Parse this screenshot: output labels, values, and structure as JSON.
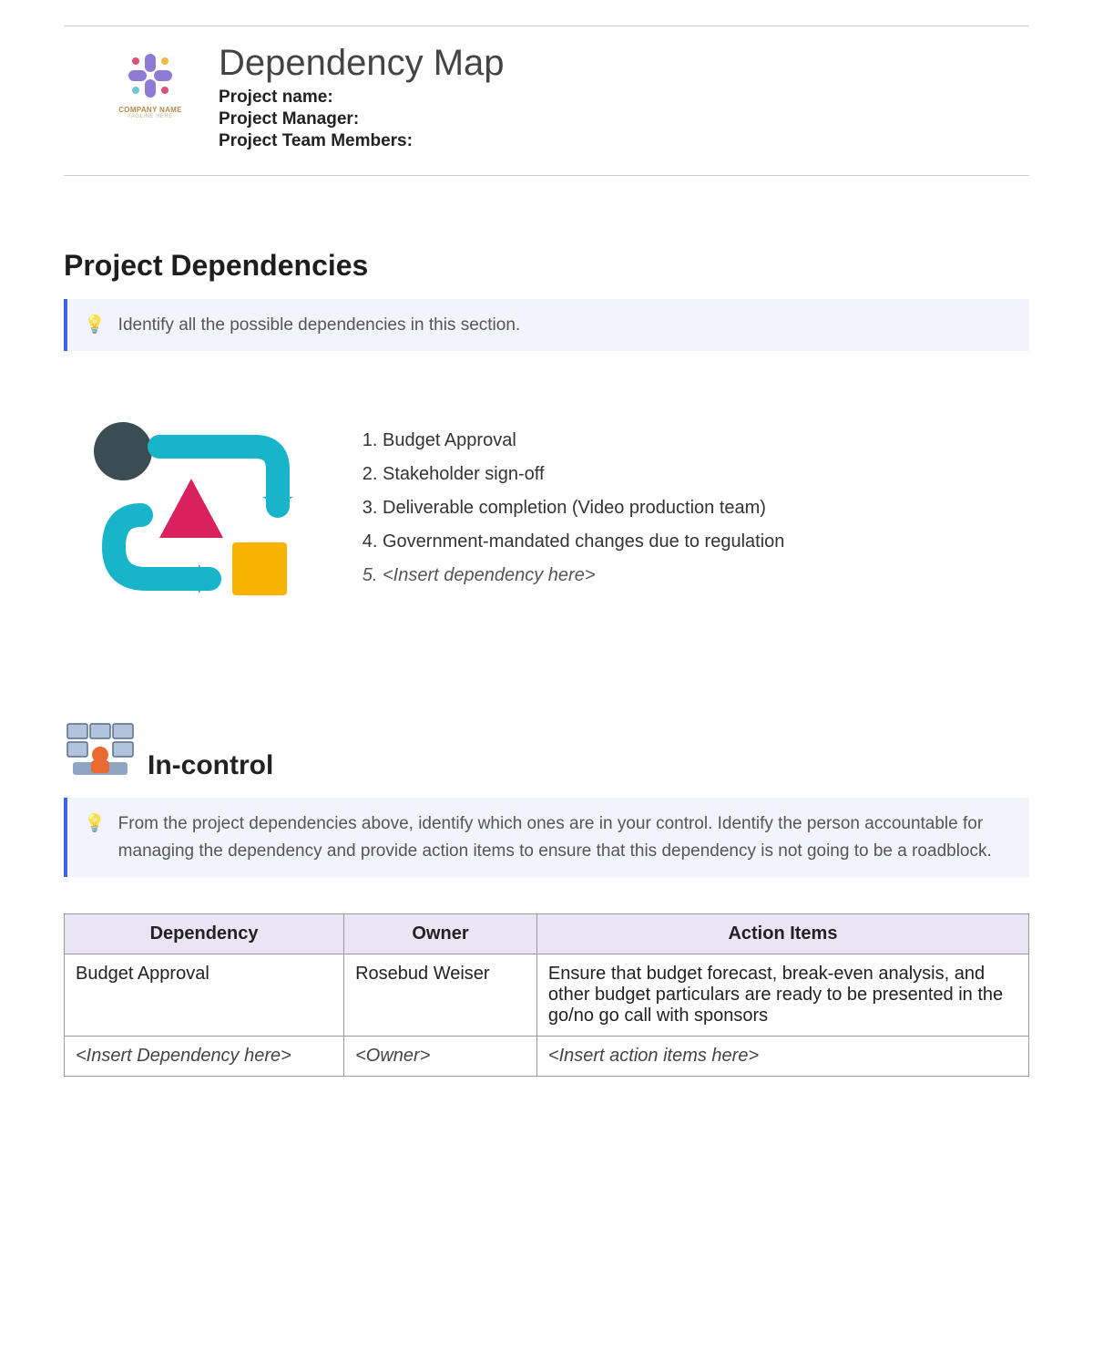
{
  "header": {
    "logo_caption": "COMPANY NAME",
    "logo_subcaption": "TAGLINE HERE",
    "title": "Dependency Map",
    "meta": {
      "project_name_label": "Project name:",
      "project_manager_label": "Project Manager:",
      "team_members_label": "Project Team Members:"
    }
  },
  "dependencies_section": {
    "heading": "Project Dependencies",
    "callout": "Identify all the possible dependencies in this section.",
    "items": [
      {
        "text": "Budget Approval",
        "placeholder": false
      },
      {
        "text": "Stakeholder sign-off",
        "placeholder": false
      },
      {
        "text": "Deliverable completion (Video production team)",
        "placeholder": false
      },
      {
        "text": "Government-mandated changes due to regulation",
        "placeholder": false
      },
      {
        "text": "<Insert dependency here>",
        "placeholder": true
      }
    ]
  },
  "incontrol_section": {
    "heading": "In-control",
    "callout": "From the project dependencies above, identify which ones are in your control. Identify the person accountable for managing the dependency and provide action items to ensure that this dependency is not going to be a roadblock.",
    "table": {
      "columns": [
        "Dependency",
        "Owner",
        "Action Items"
      ],
      "rows": [
        {
          "dependency": "Budget Approval",
          "owner": "Rosebud Weiser",
          "action": "Ensure that budget forecast, break-even analysis, and other budget particulars are ready to be presented in the go/no go call with sponsors",
          "placeholder": false
        },
        {
          "dependency": "<Insert Dependency here>",
          "owner": "<Owner>",
          "action": "<Insert action items here>",
          "placeholder": true
        }
      ]
    }
  }
}
